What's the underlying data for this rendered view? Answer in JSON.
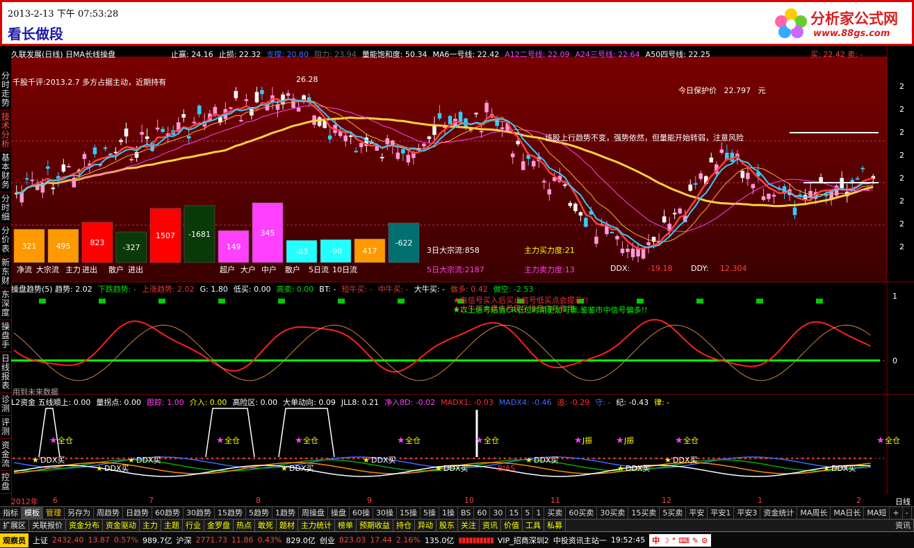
{
  "banner": {
    "datetime": "2013-2-13 下午 07:53:28",
    "slogan": "看长做段",
    "logo_title": "分析家公式网",
    "logo_url": "www.88gs.com"
  },
  "side_tabs": [
    {
      "label": "分时走势"
    },
    {
      "label": "技术分析"
    },
    {
      "label": "基本财务"
    },
    {
      "label": "分时细"
    },
    {
      "label": "分价表"
    },
    {
      "label": "新东财"
    },
    {
      "label": "东深度"
    },
    {
      "label": "操盘手"
    },
    {
      "label": "日线报表"
    },
    {
      "label": "诊测"
    },
    {
      "label": "评测"
    },
    {
      "label": "资金流"
    },
    {
      "label": "控盘"
    }
  ],
  "main_header": {
    "stock_title": "久联发展(日线) 日MA长线操盘",
    "items": [
      {
        "text": "止赢: 24.16",
        "color": "#ffffff"
      },
      {
        "text": "止损: 22.32",
        "color": "#ffffff"
      },
      {
        "text": "支撑: 20.80",
        "color": "#3b6cff"
      },
      {
        "text": "阻力: 23.94",
        "color": "#6a6a6a"
      },
      {
        "text": "量能饱和度: 50.34",
        "color": "#ffffff"
      },
      {
        "text": "MA6一号线: 22.42",
        "color": "#ffffff"
      },
      {
        "text": "A12二号线: 22.09",
        "color": "#ff40ff"
      },
      {
        "text": "A24三号线: 22.64",
        "color": "#ff40ff"
      },
      {
        "text": "A50四号线: 22.25",
        "color": "#ffffff"
      }
    ],
    "buy_sell": "买: 22.42  卖: -"
  },
  "price_panel": {
    "comment": "千股千评:2013.2.7  多方占据主动，近期持有",
    "protect_label": "今日保护价",
    "protect_value": "22.797",
    "protect_unit": "元",
    "peak_label": "26.28",
    "trend_note": "该股上行趋势不变，强势依然，但量能开始转弱，注意风险",
    "flow_labels": [
      "净流",
      "大宗流",
      "主力",
      "进出",
      "散户",
      "进出",
      "超户",
      "大户",
      "中户",
      "散户",
      "5日流",
      "10日流"
    ],
    "bar_values": [
      "321",
      "495",
      "823",
      "-327",
      "1507",
      "-1681",
      "149",
      "345",
      "-83",
      "-90",
      "417",
      "-622"
    ],
    "dazong3": "3日大宗流:858",
    "dazong5": "5日大宗流:2187",
    "buy_force": "主力买力度:21",
    "sell_force": "主力卖力度:13",
    "ddx_label": "DDX:",
    "ddx_value": "-19.18",
    "ddy_label": "DDY:",
    "ddy_value": "12.304",
    "scale": [
      "2",
      "2",
      "2",
      "2",
      "2",
      "2",
      "2",
      "2"
    ]
  },
  "osc_panel": {
    "header_items": [
      {
        "text": "操盘趋势(5) 趋势: 2.02",
        "color": "#ffffff"
      },
      {
        "text": "下跌趋势: -",
        "color": "#00e000"
      },
      {
        "text": "上涨趋势: 2.02",
        "color": "#ff3030"
      },
      {
        "text": "G: 1.80",
        "color": "#ffffff"
      },
      {
        "text": "低买: 0.00",
        "color": "#ffffff"
      },
      {
        "text": "高卖: 0.00",
        "color": "#00e000"
      },
      {
        "text": "BT: -",
        "color": "#ffffff"
      },
      {
        "text": "短牛买: -",
        "color": "#ff3030"
      },
      {
        "text": "中牛买: -",
        "color": "#ff3030"
      },
      {
        "text": "大牛买: -",
        "color": "#ffffff"
      },
      {
        "text": "做多: 0.42",
        "color": "#ff3030"
      },
      {
        "text": "做空: -2.53",
        "color": "#00e000"
      }
    ],
    "msg1": "★有信号买入后买点信号低买点会提示!!",
    "msg2": "★大牛买大卖信号提示操盘信号有用",
    "msg3": "★以上信号结合CR低位时用更加可靠,鉴鉴市中信号偏多!!",
    "footer": "用到未来数据",
    "scale_top": "1",
    "scale_bottom": "0"
  },
  "l2_panel": {
    "header_items": [
      {
        "text": "L2资金  五线顺上: 0.00",
        "color": "#ffffff"
      },
      {
        "text": "量拐点: 0.00",
        "color": "#ffffff"
      },
      {
        "text": "跟踪: 1.00",
        "color": "#ff40ff"
      },
      {
        "text": "介入: 0.00",
        "color": "#ffff00"
      },
      {
        "text": "高险区: 0.00",
        "color": "#ffffff"
      },
      {
        "text": "大单动向: 0.09",
        "color": "#ffffff"
      },
      {
        "text": "JLL8: 0.21",
        "color": "#ffffff"
      },
      {
        "text": "净入8D: -0.02",
        "color": "#ff40ff"
      },
      {
        "text": "MADX1: -0.03",
        "color": "#ff3030"
      },
      {
        "text": "MADX4: -0.46",
        "color": "#3b6cff"
      },
      {
        "text": "追: -0.29",
        "color": "#ff3030"
      },
      {
        "text": "守: -",
        "color": "#3b6cff"
      },
      {
        "text": "纪: -0.43",
        "color": "#ffffff"
      },
      {
        "text": "律: -",
        "color": "#ffff00"
      }
    ],
    "full_label": "全仓",
    "jzhen_label": "J振",
    "ddx_buy": "DDX买",
    "bias_label": "BIAS"
  },
  "timeline": {
    "year": "2012年",
    "months": [
      "6",
      "7",
      "8",
      "9",
      "10",
      "11",
      "12",
      "1",
      "2"
    ],
    "end": "日线"
  },
  "tabs": [
    "指标",
    "模板",
    "管理",
    "另存为",
    "周趋势",
    "日趋势",
    "60趋势",
    "30趋势",
    "15趋势",
    "5趋势",
    "1趋势",
    "周操盘",
    "操盘",
    "60操",
    "30操",
    "15操",
    "5操",
    "1操",
    "BS",
    "60",
    "30",
    "15",
    "5",
    "1",
    "买卖",
    "60买卖",
    "30买卖",
    "15买卖",
    "5买卖",
    "平安",
    "平安1",
    "平安3",
    "资金统计",
    "MA周长",
    "MA日长",
    "MA短",
    "+",
    "-",
    ">>"
  ],
  "func_buttons": [
    "扩展区",
    "关联报价",
    "资金分布",
    "资金驱动",
    "主力",
    "主题",
    "行业",
    "金罗盘",
    "热点",
    "敢死",
    "题材",
    "主力统计",
    "榜单",
    "预期收益",
    "持仓",
    "异动",
    "股东",
    "关注",
    "资讯",
    "价值",
    "工具",
    "私募",
    "资讯"
  ],
  "status": {
    "observer": "观察员",
    "sh_label": "上证",
    "sh_value": "2432.40",
    "sh_change": "13.87",
    "sh_pct": "0.57%",
    "sh_amount": "989.7亿",
    "hs_label": "沪深",
    "hs_value": "2771.73",
    "hs_change": "11.86",
    "hs_pct": "0.43%",
    "hs_amount": "829.0亿",
    "cy_label": "创业",
    "cy_value": "823.03",
    "cy_change": "17.44",
    "cy_pct": "2.16%",
    "cy_amount": "135.0亿",
    "server": "VIP_招商深圳2",
    "news": "中投资讯主站一",
    "time": "19:52:45",
    "ime": "中"
  },
  "colors": {
    "panel_bg": "#5a0000",
    "up": "#ff4040",
    "down": "#33ccff",
    "pink": "#ff99dd",
    "ma_yellow": "#ffd040"
  }
}
